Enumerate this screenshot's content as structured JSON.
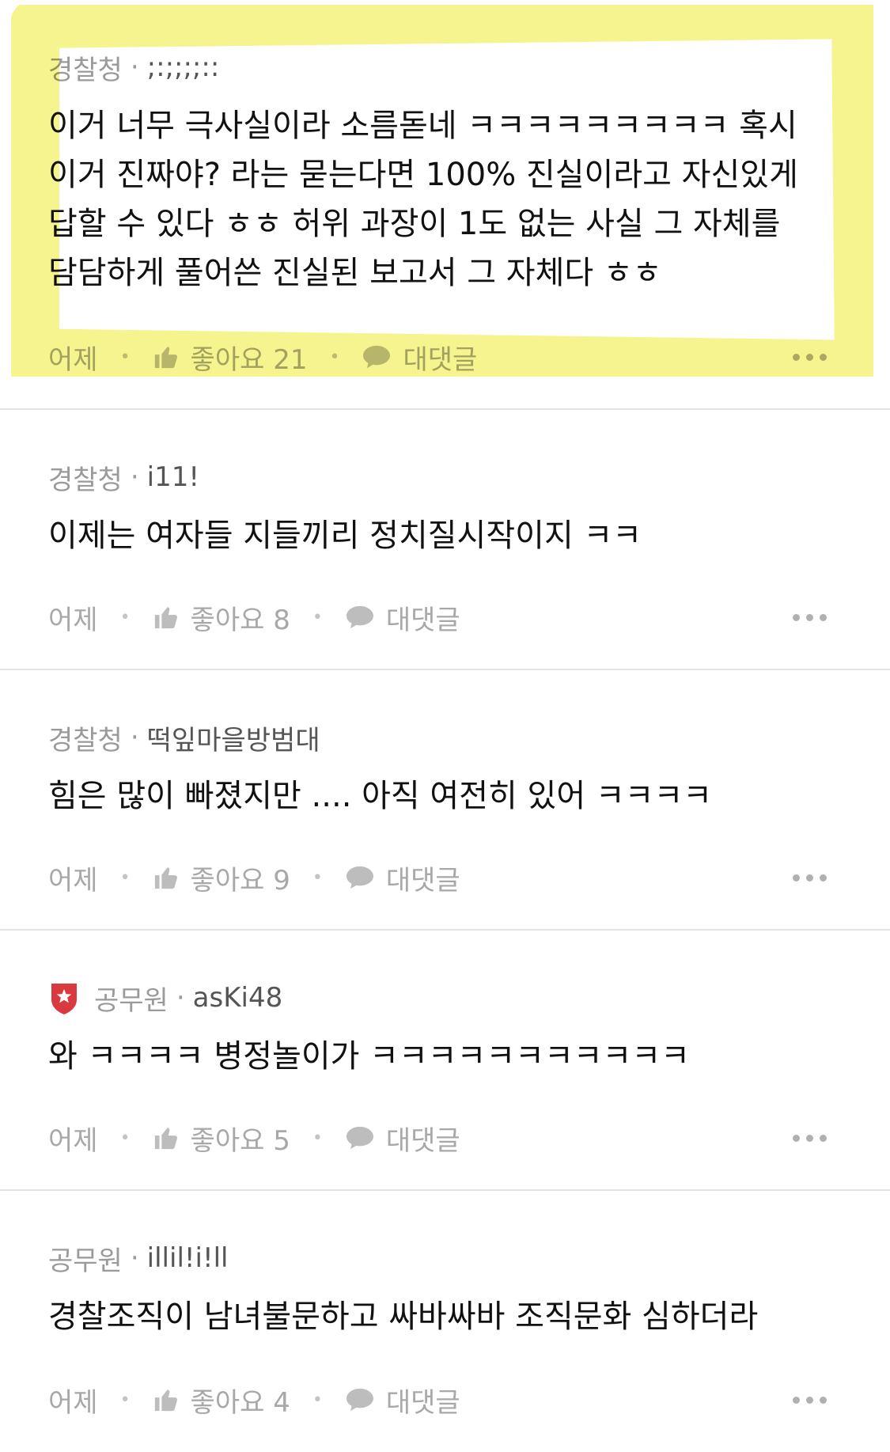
{
  "highlight_color": "#f5f27a",
  "badge_color": "#d83a3f",
  "comments": [
    {
      "group": "경찰청",
      "nickname": ";:;;;;::",
      "badge": "",
      "text": "이거 너무 극사실이라 소름돋네 ㅋㅋㅋㅋㅋㅋㅋㅋㅋ 혹시 이거 진짜야? 라는 묻는다면 100% 진실이라고 자신있게 답할 수 있다 ㅎㅎ 허위 과장이 1도 없는 사실 그 자체를 담담하게 풀어쓴 진실된 보고서 그 자체다 ㅎㅎ",
      "time": "어제",
      "like_label": "좋아요 21",
      "reply_label": "대댓글"
    },
    {
      "group": "경찰청",
      "nickname": "i11!",
      "badge": "",
      "text": "이제는 여자들 지들끼리 정치질시작이지 ㅋㅋ",
      "time": "어제",
      "like_label": "좋아요 8",
      "reply_label": "대댓글"
    },
    {
      "group": "경찰청",
      "nickname": "떡잎마을방범대",
      "badge": "",
      "text": "힘은 많이 빠졌지만 .... 아직 여전히 있어 ㅋㅋㅋㅋ",
      "time": "어제",
      "like_label": "좋아요 9",
      "reply_label": "대댓글"
    },
    {
      "group": "공무원",
      "nickname": "asKi48",
      "badge": "star-shield-badge-icon",
      "text": "와 ㅋㅋㅋㅋ 병정놀이가 ㅋㅋㅋㅋㅋㅋㅋㅋㅋㅋㅋ",
      "time": "어제",
      "like_label": "좋아요 5",
      "reply_label": "대댓글"
    },
    {
      "group": "공무원",
      "nickname": "illil!i!ll",
      "badge": "",
      "text": "경찰조직이 남녀불문하고 싸바싸바 조직문화 심하더라",
      "time": "어제",
      "like_label": "좋아요 4",
      "reply_label": "대댓글"
    }
  ]
}
